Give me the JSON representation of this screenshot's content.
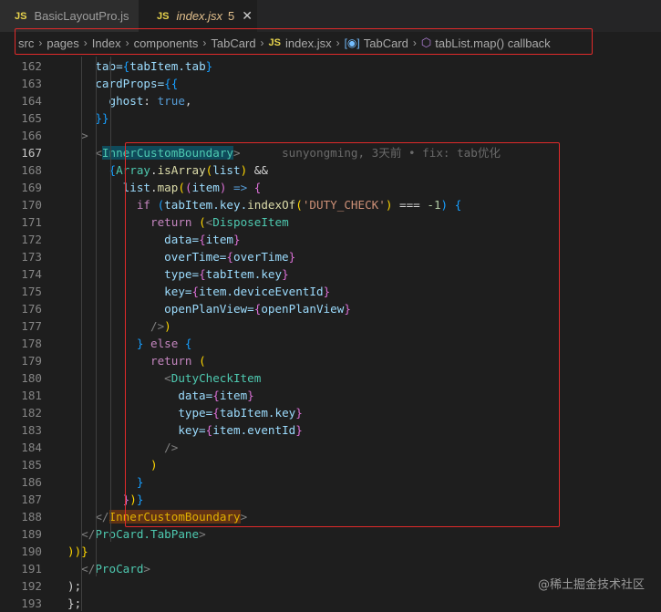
{
  "tabs": [
    {
      "badge": "JS",
      "label": "BasicLayoutPro.js"
    },
    {
      "badge": "JS",
      "label": "index.jsx",
      "modified_count": "5",
      "close": "✕"
    }
  ],
  "breadcrumb": {
    "items": [
      "src",
      "pages",
      "Index",
      "components",
      "TabCard"
    ],
    "file_badge": "JS",
    "file": "index.jsx",
    "symbol1": "TabCard",
    "symbol2": "tabList.map() callback",
    "separator": "›"
  },
  "blame": "sunyongming, 3天前 • fix: tab优化",
  "watermark": "@稀土掘金技术社区",
  "line_numbers": [
    "162",
    "163",
    "164",
    "165",
    "166",
    "167",
    "168",
    "169",
    "170",
    "171",
    "172",
    "173",
    "174",
    "175",
    "176",
    "177",
    "178",
    "179",
    "180",
    "181",
    "182",
    "183",
    "184",
    "185",
    "186",
    "187",
    "188",
    "189",
    "190",
    "191",
    "192",
    "193"
  ],
  "active_line": "167",
  "lines": [
    [
      [
        "    tab=",
        "attr"
      ],
      [
        "{",
        "brace3"
      ],
      [
        "tabItem.tab",
        "var"
      ],
      [
        "}",
        "brace3"
      ]
    ],
    [
      [
        "    cardProps=",
        "attr"
      ],
      [
        "{{",
        "brace3"
      ]
    ],
    [
      [
        "      ghost",
        "attr"
      ],
      [
        ": ",
        "txt"
      ],
      [
        "true",
        "bool"
      ],
      [
        ",",
        "txt"
      ]
    ],
    [
      [
        "    }}",
        "brace3"
      ]
    ],
    [
      [
        "  >",
        "punc"
      ]
    ],
    [
      [
        "    <",
        "punc"
      ],
      [
        "InnerCustomBoundary",
        "tag-hl"
      ],
      [
        ">",
        "punc"
      ],
      [
        "      ",
        "txt"
      ]
    ],
    [
      [
        "      {",
        "brace3"
      ],
      [
        "Array",
        "tag"
      ],
      [
        ".",
        "txt"
      ],
      [
        "isArray",
        "fn"
      ],
      [
        "(",
        "brace2"
      ],
      [
        "list",
        "var"
      ],
      [
        ") ",
        "brace2"
      ],
      [
        "&&",
        "txt"
      ]
    ],
    [
      [
        "        list",
        "var"
      ],
      [
        ".",
        "txt"
      ],
      [
        "map",
        "fn"
      ],
      [
        "(",
        "brace2"
      ],
      [
        "(",
        "brace"
      ],
      [
        "item",
        "var"
      ],
      [
        ") ",
        "brace"
      ],
      [
        "=> ",
        "bool"
      ],
      [
        "{",
        "brace"
      ]
    ],
    [
      [
        "          if ",
        "kw"
      ],
      [
        "(",
        "brace3"
      ],
      [
        "tabItem.key.",
        "var"
      ],
      [
        "indexOf",
        "fn"
      ],
      [
        "(",
        "brace2"
      ],
      [
        "'DUTY_CHECK'",
        "str"
      ],
      [
        ")",
        "brace2"
      ],
      [
        " === ",
        "txt"
      ],
      [
        "-1",
        "num"
      ],
      [
        ")",
        "brace3"
      ],
      [
        " {",
        "brace3"
      ]
    ],
    [
      [
        "            return ",
        "kw"
      ],
      [
        "(",
        "brace2"
      ],
      [
        "<",
        "punc"
      ],
      [
        "DisposeItem",
        "tag"
      ]
    ],
    [
      [
        "              data=",
        "attr"
      ],
      [
        "{",
        "brace"
      ],
      [
        "item",
        "var"
      ],
      [
        "}",
        "brace"
      ]
    ],
    [
      [
        "              overTime=",
        "attr"
      ],
      [
        "{",
        "brace"
      ],
      [
        "overTime",
        "var"
      ],
      [
        "}",
        "brace"
      ]
    ],
    [
      [
        "              type=",
        "attr"
      ],
      [
        "{",
        "brace"
      ],
      [
        "tabItem.key",
        "var"
      ],
      [
        "}",
        "brace"
      ]
    ],
    [
      [
        "              key=",
        "attr"
      ],
      [
        "{",
        "brace"
      ],
      [
        "item.deviceEventId",
        "var"
      ],
      [
        "}",
        "brace"
      ]
    ],
    [
      [
        "              openPlanView=",
        "attr"
      ],
      [
        "{",
        "brace"
      ],
      [
        "openPlanView",
        "var"
      ],
      [
        "}",
        "brace"
      ]
    ],
    [
      [
        "            />",
        "punc"
      ],
      [
        ")",
        "brace2"
      ]
    ],
    [
      [
        "          }",
        "brace3"
      ],
      [
        " else ",
        "kw"
      ],
      [
        "{",
        "brace3"
      ]
    ],
    [
      [
        "            return ",
        "kw"
      ],
      [
        "(",
        "brace2"
      ]
    ],
    [
      [
        "              <",
        "punc"
      ],
      [
        "DutyCheckItem",
        "tag"
      ]
    ],
    [
      [
        "                data=",
        "attr"
      ],
      [
        "{",
        "brace"
      ],
      [
        "item",
        "var"
      ],
      [
        "}",
        "brace"
      ]
    ],
    [
      [
        "                type=",
        "attr"
      ],
      [
        "{",
        "brace"
      ],
      [
        "tabItem.key",
        "var"
      ],
      [
        "}",
        "brace"
      ]
    ],
    [
      [
        "                key=",
        "attr"
      ],
      [
        "{",
        "brace"
      ],
      [
        "item.eventId",
        "var"
      ],
      [
        "}",
        "brace"
      ]
    ],
    [
      [
        "              />",
        "punc"
      ]
    ],
    [
      [
        "            )",
        "brace2"
      ]
    ],
    [
      [
        "          }",
        "brace3"
      ]
    ],
    [
      [
        "        }",
        "brace"
      ],
      [
        ")",
        "brace2"
      ],
      [
        "}",
        "brace3"
      ]
    ],
    [
      [
        "    </",
        "punc"
      ],
      [
        "InnerCustomBoundary",
        "tag-hl2"
      ],
      [
        ">",
        "punc"
      ]
    ],
    [
      [
        "  </",
        "punc"
      ],
      [
        "ProCard.TabPane",
        "tag"
      ],
      [
        ">",
        "punc"
      ]
    ],
    [
      [
        "))}",
        "brace2"
      ]
    ],
    [
      [
        "  </",
        "punc"
      ],
      [
        "ProCard",
        "tag"
      ],
      [
        ">",
        "punc"
      ]
    ],
    [
      [
        ");",
        "txt"
      ]
    ],
    [
      [
        "};",
        "txt"
      ]
    ]
  ]
}
